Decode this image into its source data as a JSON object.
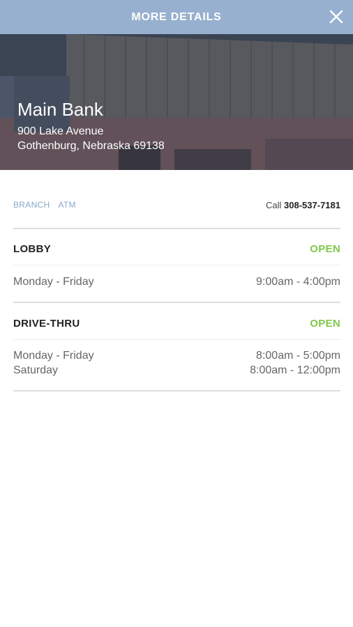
{
  "header": {
    "title": "MORE DETAILS",
    "close_icon": "close-icon"
  },
  "location": {
    "name": "Main Bank",
    "address_line1": "900 Lake Avenue",
    "address_line2": "Gothenburg, Nebraska 69138"
  },
  "tabs": [
    {
      "label": "BRANCH"
    },
    {
      "label": "ATM"
    }
  ],
  "call": {
    "label": "Call",
    "phone": "308-537-7181"
  },
  "sections": {
    "lobby": {
      "title": "LOBBY",
      "status": "OPEN",
      "hours": [
        {
          "days": "Monday - Friday",
          "time": "9:00am - 4:00pm"
        }
      ]
    },
    "drive_thru": {
      "title": "DRIVE-THRU",
      "status": "OPEN",
      "hours": [
        {
          "days": "Monday - Friday",
          "time": "8:00am - 5:00pm"
        },
        {
          "days": "Saturday",
          "time": "8:00am - 12:00pm"
        }
      ]
    }
  },
  "colors": {
    "header_bg": "#97b0cf",
    "open_status": "#7fc84a",
    "tab_text": "#8aa8c8"
  }
}
